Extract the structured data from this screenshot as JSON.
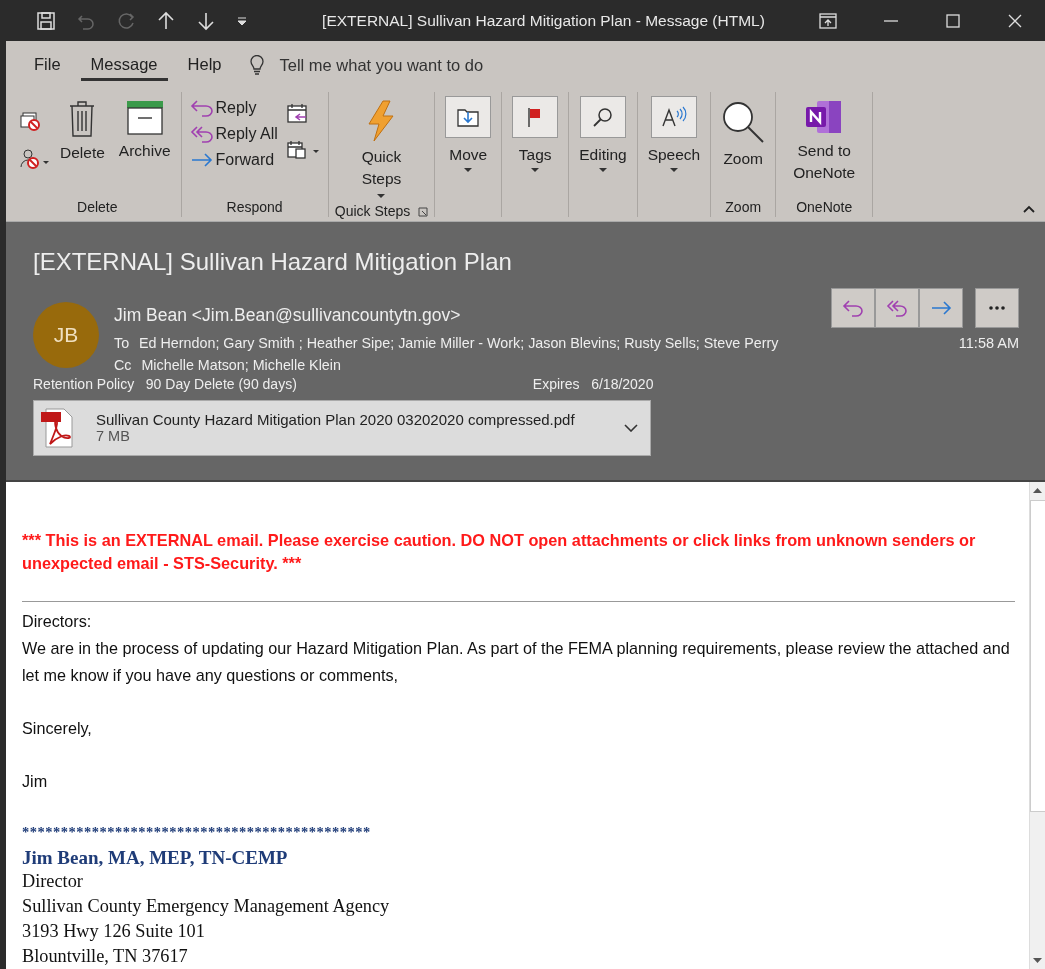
{
  "title_bar": {
    "title": "[EXTERNAL] Sullivan Hazard Mitigation Plan  -  Message (HTML)"
  },
  "tabs": [
    {
      "label": "File",
      "selected": false
    },
    {
      "label": "Message",
      "selected": true
    },
    {
      "label": "Help",
      "selected": false
    }
  ],
  "tell_me": {
    "placeholder": "Tell me what you want to do"
  },
  "ribbon": {
    "groups": [
      {
        "label": "Delete",
        "buttons": [
          "Delete",
          "Archive"
        ]
      },
      {
        "label": "Respond",
        "buttons": [
          "Reply",
          "Reply All",
          "Forward"
        ]
      },
      {
        "label": "Quick Steps",
        "buttons": [
          "Quick Steps"
        ]
      },
      {
        "buttons": [
          "Move",
          "Tags",
          "Editing",
          "Speech"
        ]
      },
      {
        "label": "Zoom",
        "buttons": [
          "Zoom"
        ]
      },
      {
        "label": "OneNote",
        "buttons": [
          "Send to OneNote"
        ]
      }
    ]
  },
  "message": {
    "subject": "[EXTERNAL] Sullivan Hazard Mitigation Plan",
    "sender": {
      "initials": "JB",
      "name": "Jim Bean <Jim.Bean@sullivancountytn.gov>"
    },
    "to": {
      "label": "To",
      "value": "Ed Herndon; Gary Smith ; Heather Sipe; Jamie Miller - Work; Jason Blevins; Rusty Sells; Steve Perry"
    },
    "cc": {
      "label": "Cc",
      "value": "Michelle Matson; Michelle Klein"
    },
    "time": "11:58 AM",
    "retention": {
      "label": "Retention Policy",
      "value": "90 Day Delete (90 days)"
    },
    "expires": {
      "label": "Expires",
      "value": "6/18/2020"
    },
    "attachment": {
      "name": "Sullivan County Hazard Mitigation Plan 2020 03202020 compressed.pdf",
      "size": "7 MB"
    }
  },
  "body": {
    "warning": "*** This is an EXTERNAL email. Please exercise caution. DO NOT open attachments or click links from unknown senders or unexpected email - STS-Security. ***",
    "greeting": "Directors:",
    "paragraph": "We are in the process of updating our Hazard Mitigation Plan. As part of the FEMA planning requirements, please review the attached and let me know if you have any questions or comments,",
    "closing": "Sincerely,",
    "name": "Jim",
    "signature": {
      "rule": "*********************************************",
      "name": "Jim Bean, MA, MEP, TN-CEMP",
      "lines": [
        "Director",
        "Sullivan County Emergency Management Agency",
        "3193 Hwy 126 Suite 101",
        "Blountville, TN 37617"
      ]
    }
  }
}
